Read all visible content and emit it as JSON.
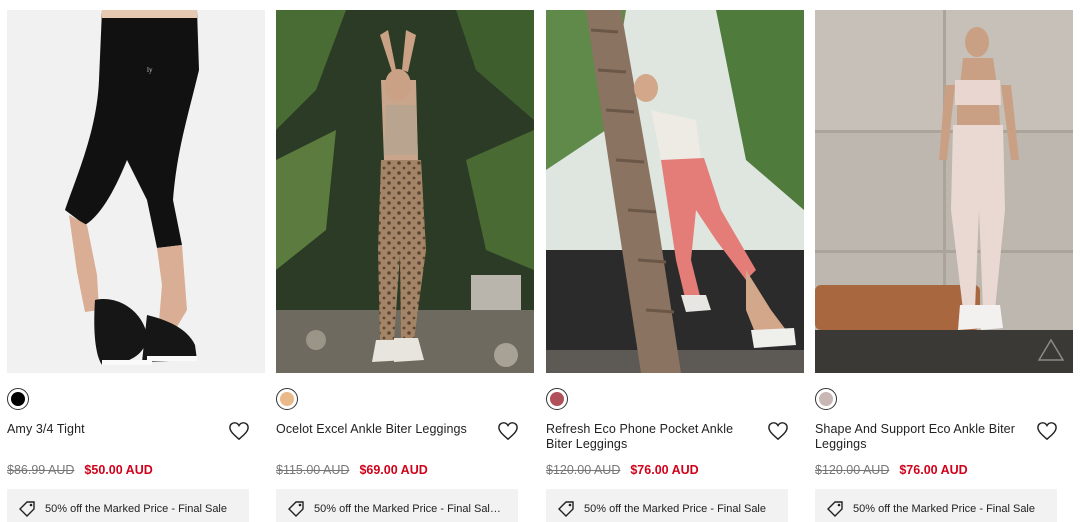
{
  "products": [
    {
      "name": "Amy 3/4 Tight",
      "swatch_color": "#000000",
      "old_price": "$86.99 AUD",
      "price": "$50.00 AUD",
      "promo": "50% off the Marked Price - Final Sale"
    },
    {
      "name": "Ocelot Excel Ankle Biter Leggings",
      "swatch_color": "#e9b98a",
      "old_price": "$115.00 AUD",
      "price": "$69.00 AUD",
      "promo": "50% off the Marked Price - Final Sal…"
    },
    {
      "name": "Refresh Eco Phone Pocket Ankle Biter Leggings",
      "swatch_color": "#b0505a",
      "old_price": "$120.00 AUD",
      "price": "$76.00 AUD",
      "promo": "50% off the Marked Price - Final Sale"
    },
    {
      "name": "Shape And Support Eco Ankle Biter Leggings",
      "swatch_color": "#c9b7b6",
      "old_price": "$120.00 AUD",
      "price": "$76.00 AUD",
      "promo": "50% off the Marked Price - Final Sale"
    }
  ]
}
